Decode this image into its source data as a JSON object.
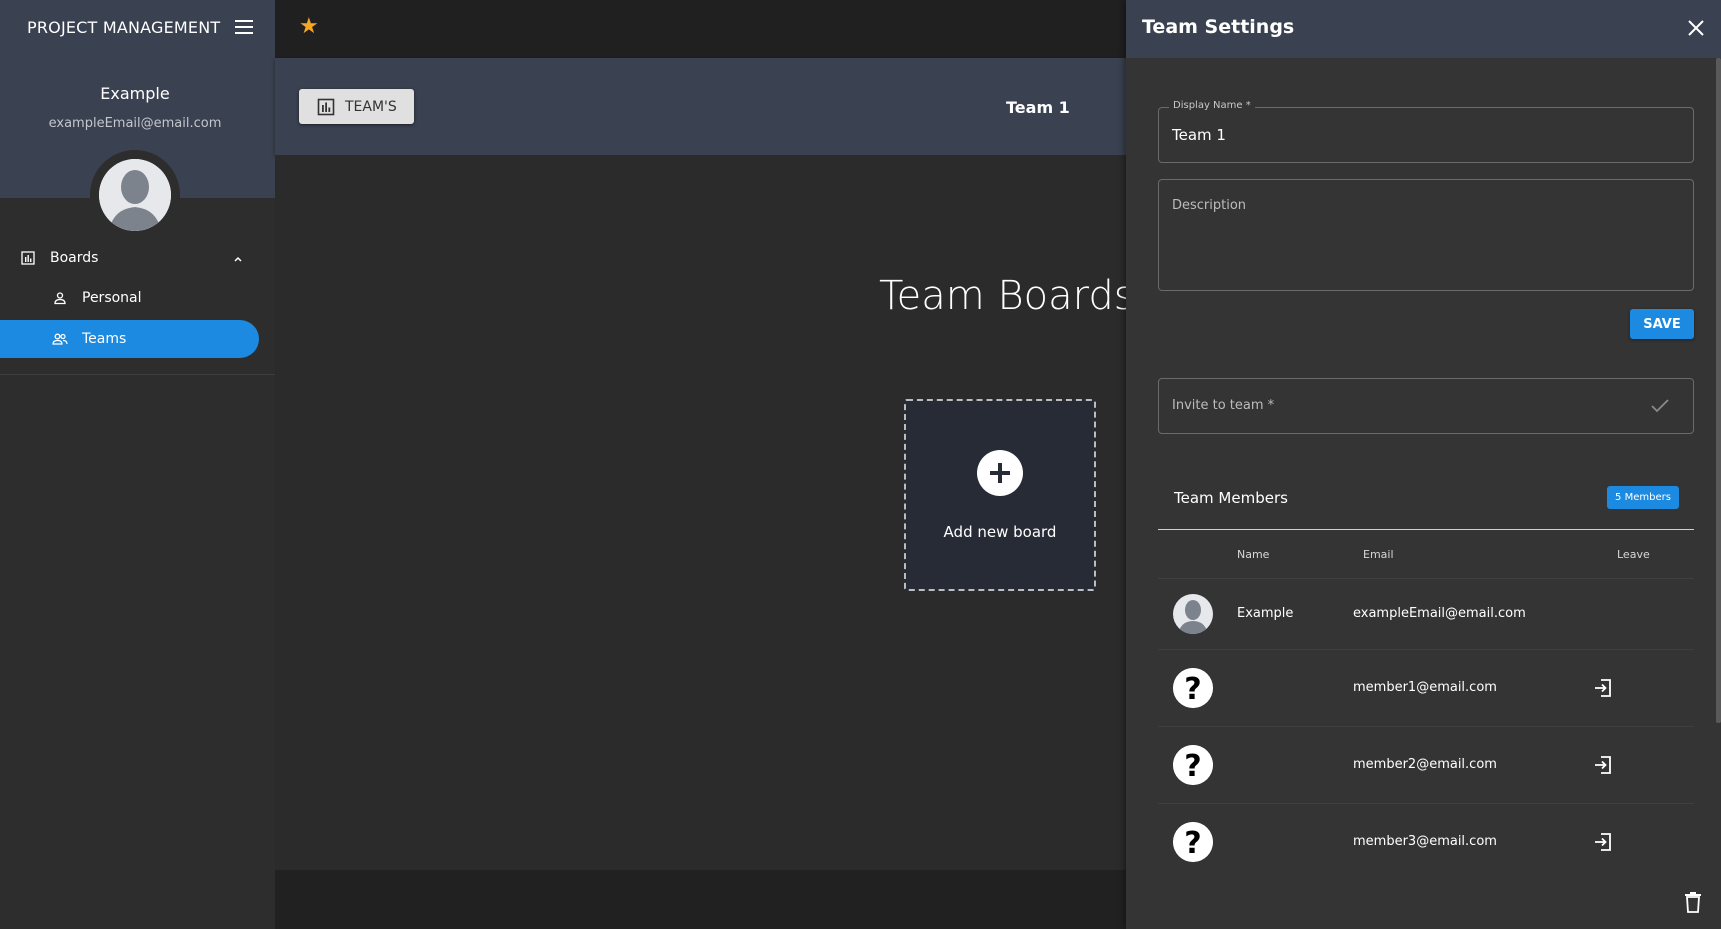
{
  "app": {
    "title": "PROJECT MANAGEMENT"
  },
  "user": {
    "name": "Example",
    "email": "exampleEmail@email.com"
  },
  "nav": {
    "boards_label": "Boards",
    "personal_label": "Personal",
    "teams_label": "Teams"
  },
  "header": {
    "teams_button": "TEAM'S",
    "team_name": "Team 1"
  },
  "main": {
    "title": "Team Boards",
    "add_board_label": "Add new board"
  },
  "settings": {
    "title": "Team Settings",
    "display_name_label": "Display Name *",
    "display_name_value": "Team 1",
    "description_placeholder": "Description",
    "save_label": "SAVE",
    "invite_placeholder": "Invite to team *",
    "members_title": "Team Members",
    "members_badge": "5 Members",
    "columns": {
      "name": "Name",
      "email": "Email",
      "leave": "Leave"
    },
    "members": [
      {
        "name": "Example",
        "email": "exampleEmail@email.com",
        "avatar": "user-photo",
        "can_leave": false
      },
      {
        "name": "",
        "email": "member1@email.com",
        "avatar": "unknown-user-icon",
        "can_leave": true
      },
      {
        "name": "",
        "email": "member2@email.com",
        "avatar": "unknown-user-icon",
        "can_leave": true
      },
      {
        "name": "",
        "email": "member3@email.com",
        "avatar": "unknown-user-icon",
        "can_leave": true
      }
    ]
  },
  "colors": {
    "accent": "#1b8ae0",
    "header_bg": "#3a4150",
    "star": "#f5a623"
  }
}
